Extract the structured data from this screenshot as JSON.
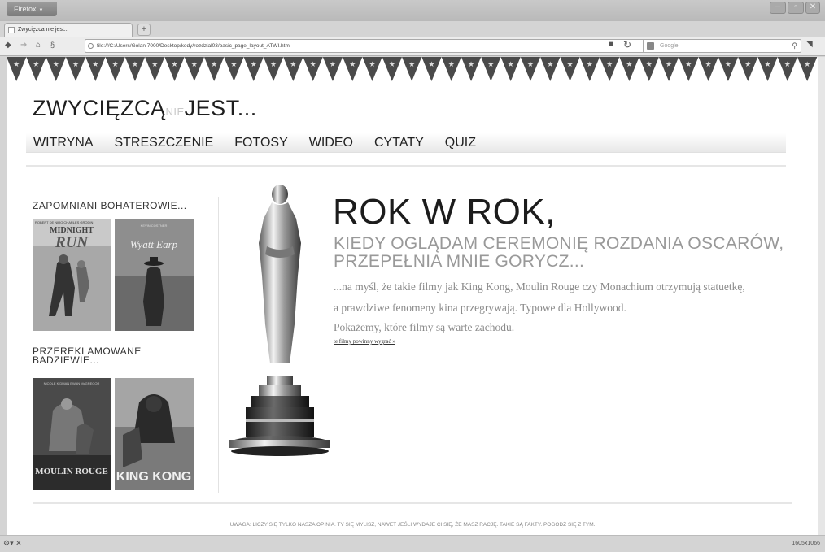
{
  "browser": {
    "app_button": "Firefox",
    "tab_title": "Zwycięzca nie jest...",
    "new_tab": "+",
    "url": "file:///C:/Users/Golan 7000/Desktop/kody/rozdzial03/basic_page_layout_ATWI.html",
    "search_placeholder": "Google",
    "status_right": "1605x1066",
    "colors": {
      "chrome": "#d4d4d4",
      "page_bg": "#ffffff"
    }
  },
  "page": {
    "title_main": "ZWYCIĘZCĄ",
    "title_nie": "NIE",
    "title_end": "JEST...",
    "nav": [
      "WITRYNA",
      "STRESZCZENIE",
      "FOTOSY",
      "WIDEO",
      "CYTATY",
      "QUIZ"
    ],
    "sidebar": {
      "heading1": "ZAPOMNIANI BOHATEROWIE...",
      "heading2": "PRZEREKLAMOWANE BADZIEWIE...",
      "posters": {
        "p1_actors": "ROBERT DE NIRO   CHARLES GRODIN",
        "p1_title_a": "MIDNIGHT",
        "p1_title_b": "RUN",
        "p2_actor": "KEVIN COSTNER",
        "p2_title": "Wyatt Earp",
        "p3_actors": "NICOLE KIDMAN   EWAN McGREGOR",
        "p3_title": "MOULIN ROUGE",
        "p4_title": "KING KONG"
      }
    },
    "headline": "ROK W ROK,",
    "subhead": "KIEDY OGLĄDAM CEREMONIĘ ROZDANIA OSCARÓW, PRZEPEŁNIA MNIE GORYCZ...",
    "body_lines": [
      "...na myśl, że takie filmy jak King Kong, Moulin Rouge czy Monachium otrzymują statuetkę,",
      "a prawdziwe fenomeny kina przegrywają. Typowe dla Hollywood.",
      "Pokażemy, które filmy są warte zachodu."
    ],
    "link": "te filmy powinny wygrać »",
    "footer": "UWAGA: LICZY SIĘ TYLKO NASZA OPINIA. TY SIĘ MYLISZ, NAWET JEŚLI WYDAJE CI SIĘ, ŻE MASZ RACJĘ. TAKIE SĄ FAKTY. POGODŹ SIĘ Z TYM."
  }
}
